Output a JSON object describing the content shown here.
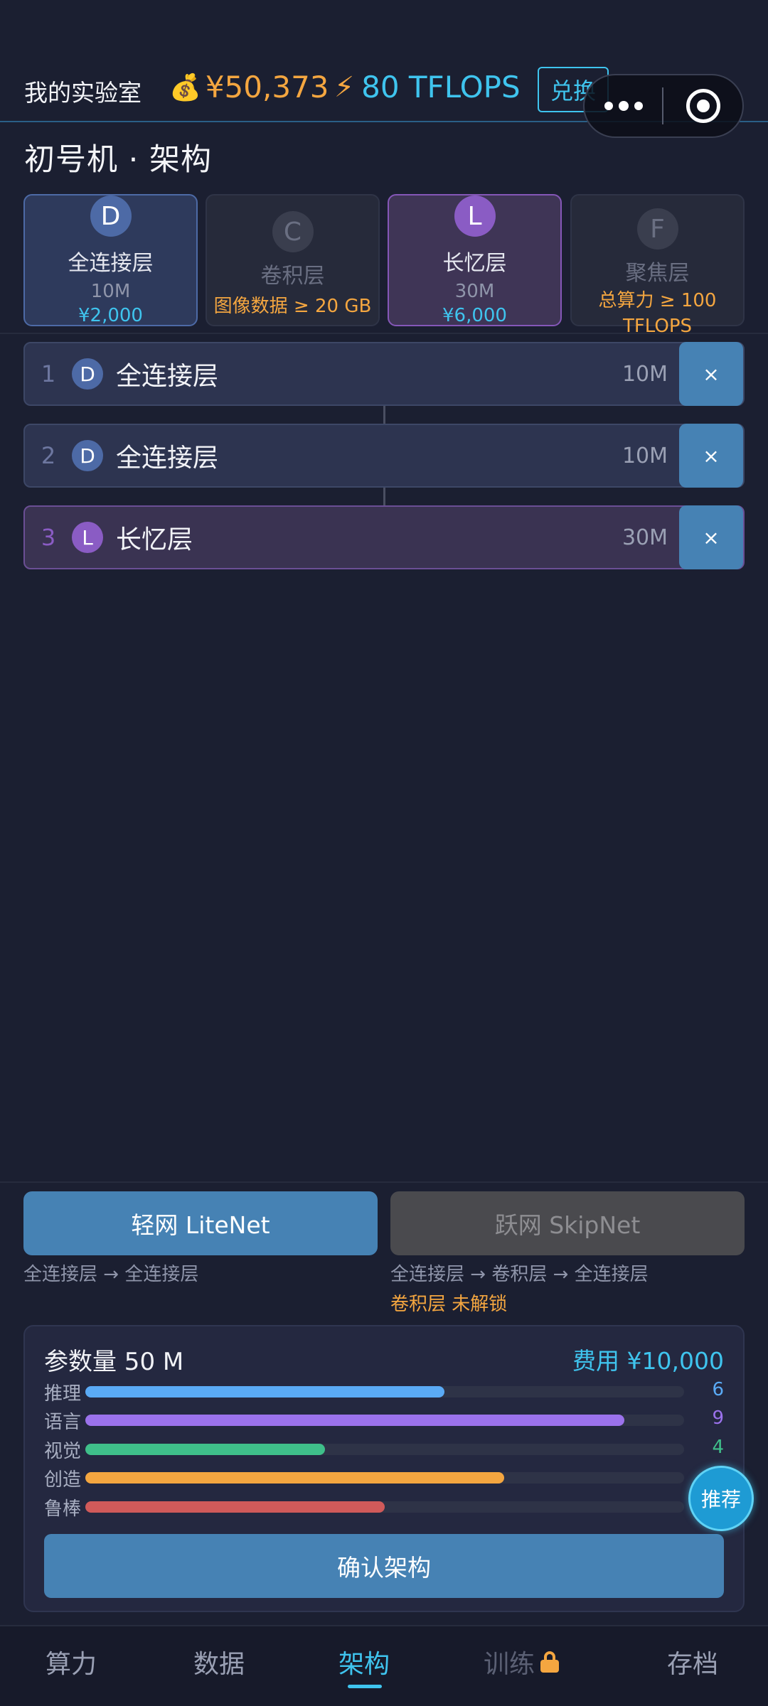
{
  "header": {
    "lab_title": "我的实验室",
    "money": "¥50,373",
    "compute": "80 TFLOPS",
    "exchange_label": "兑换"
  },
  "page_title": "初号机 · 架构",
  "palette": [
    {
      "badge": "D",
      "name": "全连接层",
      "size": "10M",
      "price": "¥2,000"
    },
    {
      "badge": "C",
      "name": "卷积层",
      "requirement": "图像数据 ≥ 20 GB"
    },
    {
      "badge": "L",
      "name": "长忆层",
      "size": "30M",
      "price": "¥6,000"
    },
    {
      "badge": "F",
      "name": "聚焦层",
      "requirement_line1": "总算力 ≥ 100",
      "requirement_line2": "TFLOPS"
    }
  ],
  "stack": [
    {
      "index": "1",
      "badge": "D",
      "name": "全连接层",
      "size": "10M",
      "delete": "×"
    },
    {
      "index": "2",
      "badge": "D",
      "name": "全连接层",
      "size": "10M",
      "delete": "×"
    },
    {
      "index": "3",
      "badge": "L",
      "name": "长忆层",
      "size": "30M",
      "delete": "×"
    }
  ],
  "presets": [
    {
      "label": "轻网 LiteNet",
      "desc": "全连接层 → 全连接层"
    },
    {
      "label": "跃网 SkipNet",
      "desc": "全连接层 → 卷积层 → 全连接层",
      "lock_note": "卷积层 未解锁"
    }
  ],
  "summary": {
    "params": "参数量 50 M",
    "cost": "费用 ¥10,000",
    "stats": [
      {
        "label": "推理",
        "value": "6",
        "fill": 0.6,
        "color": "#5aaaf5"
      },
      {
        "label": "语言",
        "value": "9",
        "fill": 0.9,
        "color": "#9b72ec"
      },
      {
        "label": "视觉",
        "value": "4",
        "fill": 0.4,
        "color": "#3fbf8a"
      },
      {
        "label": "创造",
        "value": "7",
        "fill": 0.7,
        "color": "#f4a640"
      },
      {
        "label": "鲁棒",
        "value": "5",
        "fill": 0.5,
        "color": "#d05a5a"
      }
    ],
    "confirm_label": "确认架构",
    "recommend_label": "推荐"
  },
  "tabs": [
    {
      "label": "算力"
    },
    {
      "label": "数据"
    },
    {
      "label": "架构"
    },
    {
      "label": "训练"
    },
    {
      "label": "存档"
    }
  ]
}
